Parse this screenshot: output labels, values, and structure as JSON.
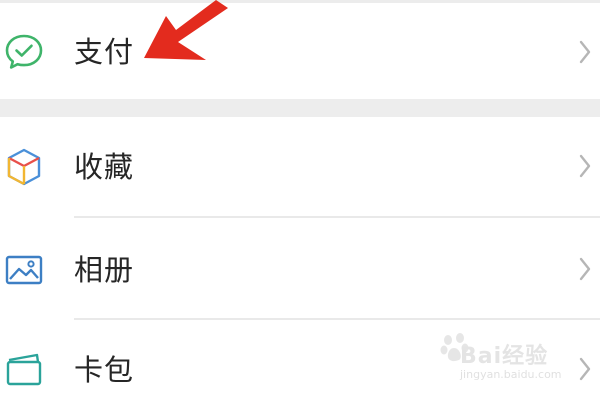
{
  "menu": {
    "items": [
      {
        "label": "支付",
        "icon": "wechat-pay-icon",
        "icon_color": "#3fb46a"
      },
      {
        "label": "收藏",
        "icon": "favorites-cube-icon",
        "icon_color": "#4a90d9"
      },
      {
        "label": "相册",
        "icon": "album-picture-icon",
        "icon_color": "#3d7fc4"
      },
      {
        "label": "卡包",
        "icon": "card-wallet-icon",
        "icon_color": "#2aa39a"
      }
    ]
  },
  "annotation": {
    "arrow_color": "#e32b1e"
  },
  "watermark": {
    "brand": "Bai经验",
    "url": "jingyan.baidu.com"
  },
  "colors": {
    "background": "#ffffff",
    "section_gap": "#ededed",
    "divider": "#e9e9e9",
    "label": "#262626",
    "chevron": "#b6b6b6"
  }
}
